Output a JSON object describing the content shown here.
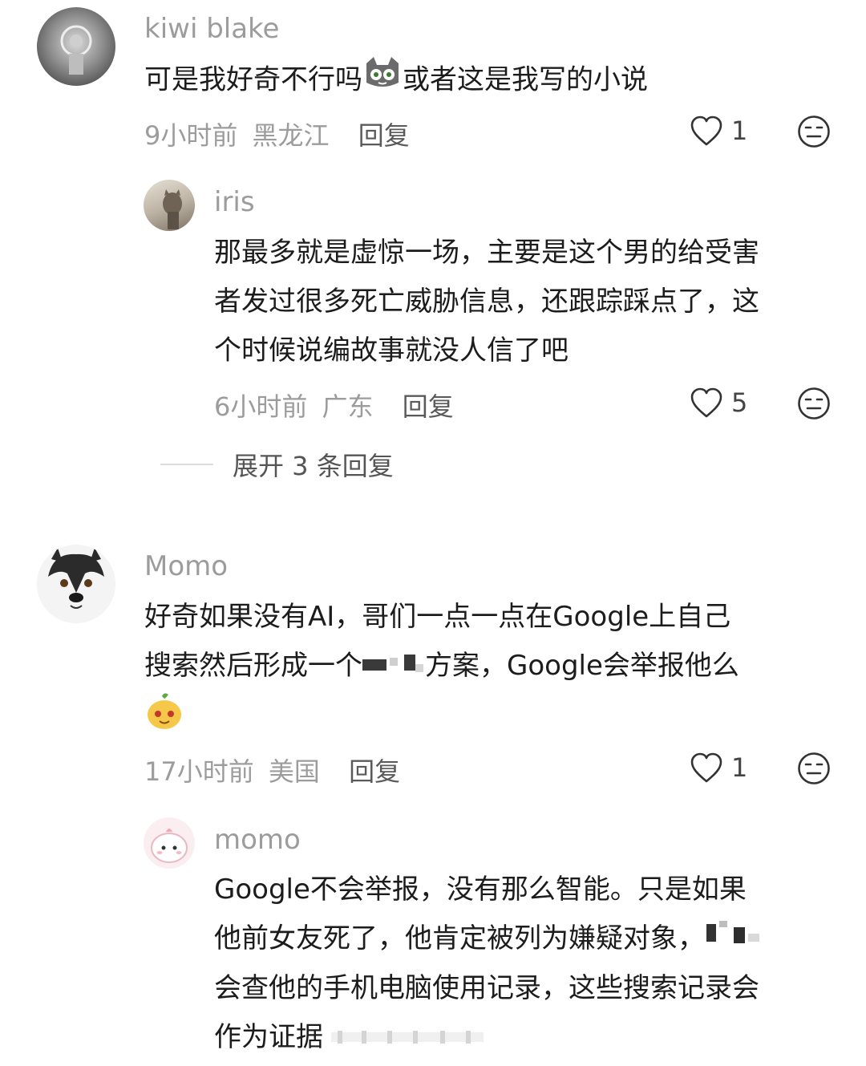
{
  "comments": [
    {
      "author": "kiwi blake",
      "text_before_emoji": "可是我好奇不行吗",
      "text_after_emoji": "或者这是我写的小说",
      "time": "9小时前",
      "location": "黑龙江",
      "reply_label": "回复",
      "likes": "1",
      "replies": [
        {
          "author": "iris",
          "lines": [
            "那最多就是虚惊一场，主要是这个男的给受害",
            "者发过很多死亡威胁信息，还跟踪踩点了，这",
            "个时候说编故事就没人信了吧"
          ],
          "time": "6小时前",
          "location": "广东",
          "reply_label": "回复",
          "likes": "5"
        }
      ],
      "expand_label": "展开 3 条回复"
    },
    {
      "author": "Momo",
      "line1": "好奇如果没有AI，哥们一点一点在Google上自己",
      "line2_before_redact": "搜索然后形成一个",
      "line2_after_redact": "方案，Google会举报他么",
      "time": "17小时前",
      "location": "美国",
      "reply_label": "回复",
      "likes": "1",
      "replies": [
        {
          "author": "momo",
          "line1": "Google不会举报，没有那么智能。只是如果",
          "line2": "他前女友死了，他肯定被列为嫌疑对象，",
          "line3": "会查他的手机电脑使用记录，这些搜索记录会",
          "line4": "作为证据"
        }
      ]
    }
  ],
  "icons": {
    "like": "heart-outline-icon",
    "dislike": "meh-face-icon",
    "emoji_cat": "cat-emoji-icon",
    "emoji_fruit": "fruit-face-emoji-icon"
  }
}
